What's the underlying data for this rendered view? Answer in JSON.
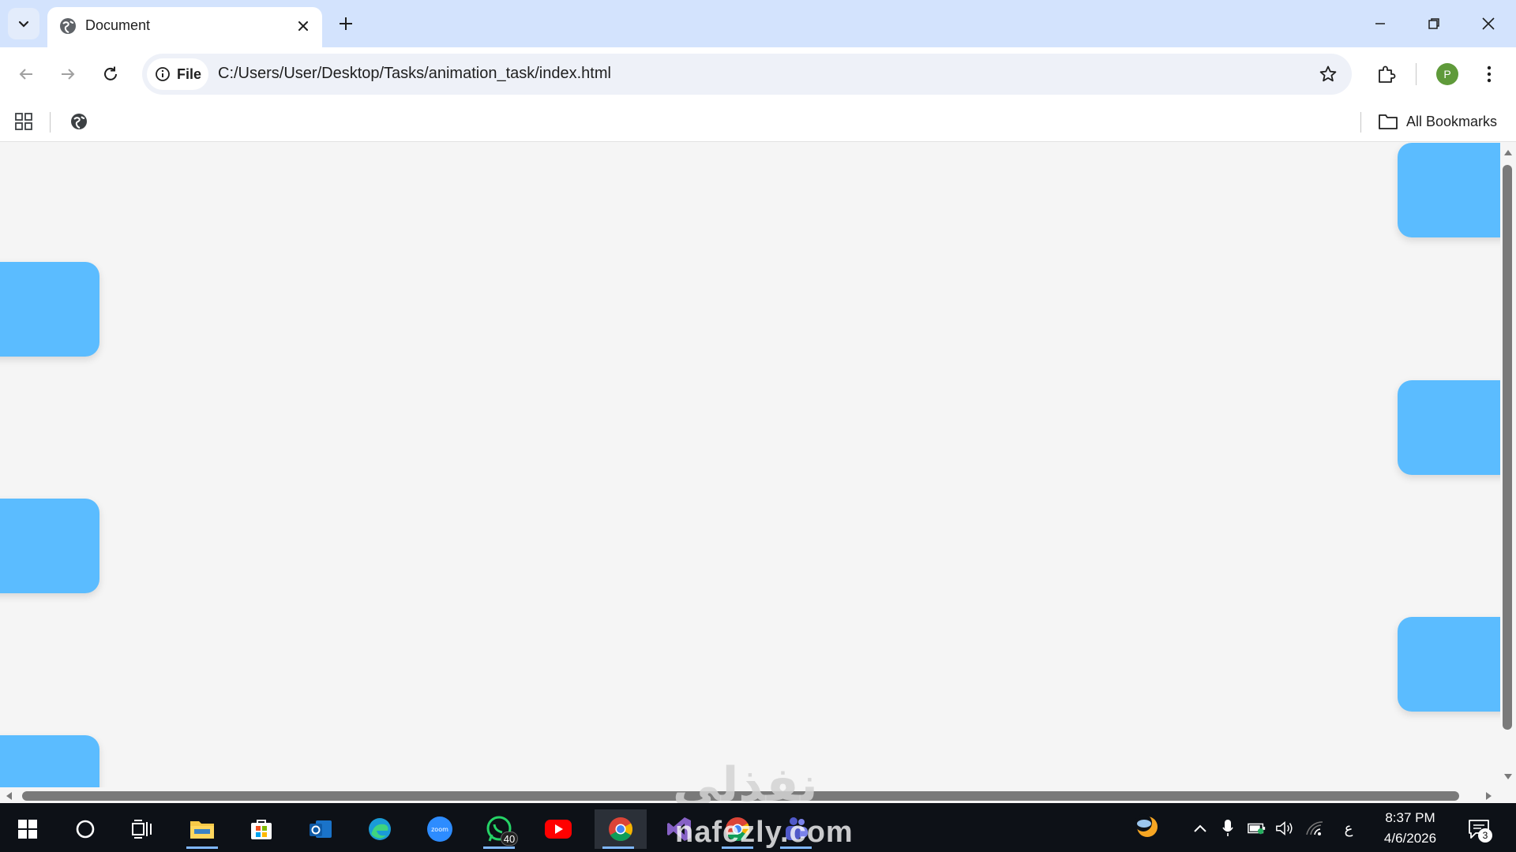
{
  "browser": {
    "tab": {
      "title": "Document"
    },
    "address": {
      "scheme_label": "File",
      "url": "C:/Users/User/Desktop/Tasks/animation_task/index.html"
    },
    "profile_initial": "P",
    "bookmarks": {
      "all_label": "All Bookmarks"
    }
  },
  "page": {
    "box_color": "#5bbcff",
    "background": "#f5f5f5"
  },
  "taskbar": {
    "apps": [
      "start-icon",
      "search-icon",
      "task-view-icon",
      "file-explorer-icon",
      "microsoft-store-icon",
      "outlook-icon",
      "edge-icon",
      "zoom-icon",
      "whatsapp-icon",
      "youtube-icon",
      "chrome-icon",
      "visual-studio-icon",
      "chrome-profile-icon",
      "teams-icon"
    ],
    "whatsapp_badge": "40",
    "zoom_label": "zoom",
    "language": "ع",
    "time": "8:37 PM",
    "date": "4/6/2026",
    "notifications": "3"
  },
  "watermark": {
    "latin": "nafezly.com",
    "arabic": "نفذلي"
  }
}
